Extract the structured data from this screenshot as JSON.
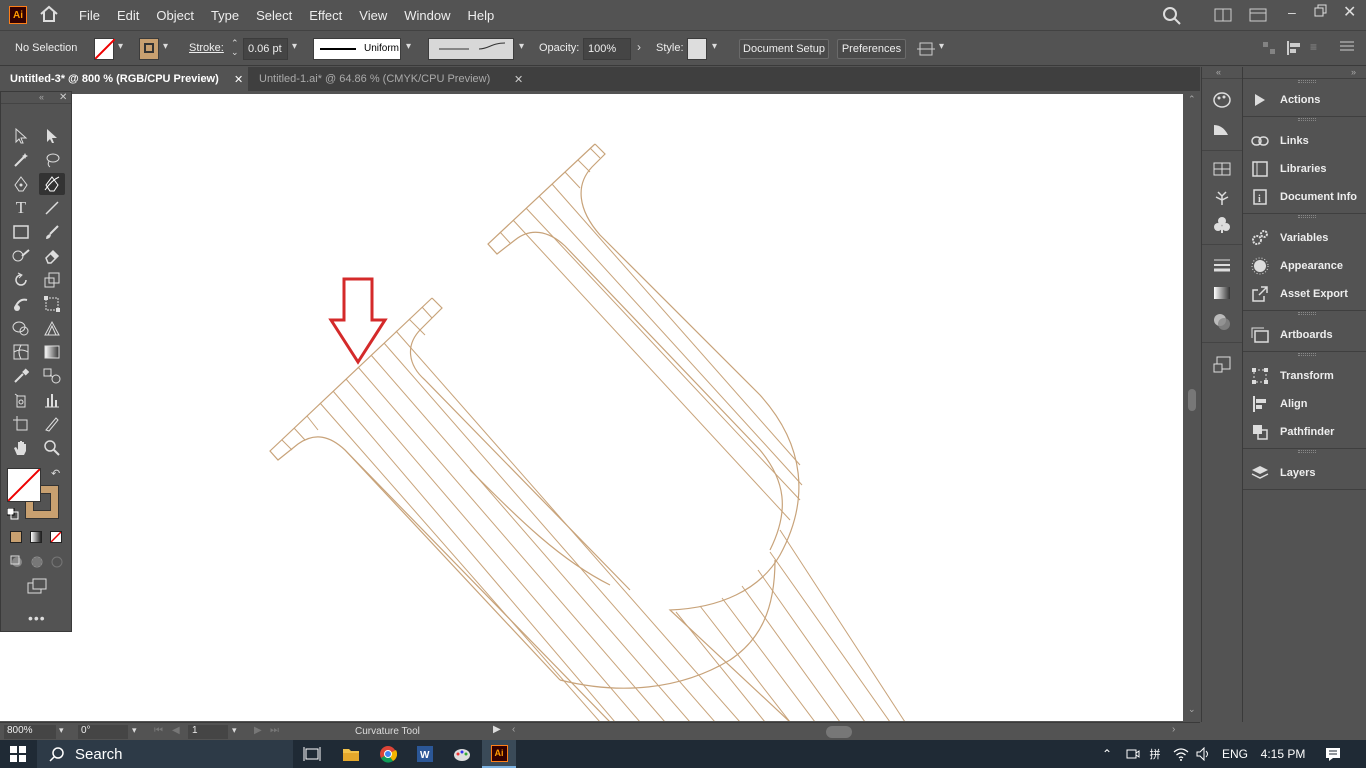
{
  "app": {
    "logo": "Ai",
    "title": "Adobe Illustrator"
  },
  "menu": [
    "File",
    "Edit",
    "Object",
    "Type",
    "Select",
    "Effect",
    "View",
    "Window",
    "Help"
  ],
  "control": {
    "selection": "No Selection",
    "stroke_label": "Stroke:",
    "stroke_value": "0.06 pt",
    "profile": "Uniform",
    "opacity_label": "Opacity:",
    "opacity_value": "100%",
    "style_label": "Style:",
    "document_setup": "Document Setup",
    "preferences": "Preferences"
  },
  "tabs": [
    {
      "label": "Untitled-3* @ 800 % (RGB/CPU Preview)",
      "active": true
    },
    {
      "label": "Untitled-1.ai* @ 64.86 % (CMYK/CPU Preview)",
      "active": false
    }
  ],
  "panels": {
    "actions": "Actions",
    "links": "Links",
    "libraries": "Libraries",
    "document_info": "Document Info",
    "variables": "Variables",
    "appearance": "Appearance",
    "asset_export": "Asset Export",
    "artboards": "Artboards",
    "transform": "Transform",
    "align": "Align",
    "pathfinder": "Pathfinder",
    "layers": "Layers"
  },
  "status": {
    "zoom": "800%",
    "rotate": "0°",
    "artboard": "1",
    "tool": "Curvature Tool"
  },
  "taskbar": {
    "search": "Search",
    "lang": "ENG",
    "time": "4:15 PM"
  },
  "colors": {
    "stroke_art": "#c8a37a",
    "arrow": "#d42a2a",
    "fill_swatch": "#c8a070",
    "accent": "#ff9a00"
  }
}
